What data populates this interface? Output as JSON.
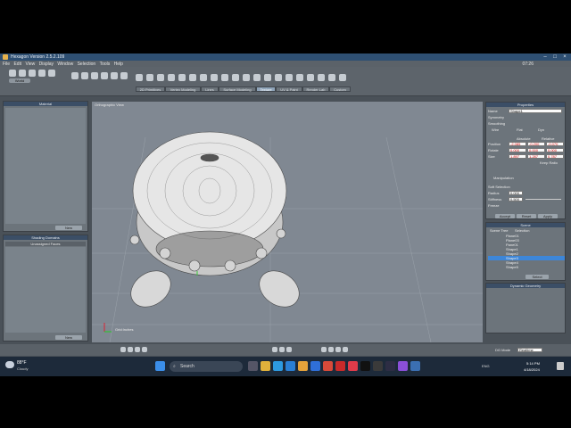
{
  "app": {
    "title": "Hexagon Version 2.5.2.109",
    "menus": [
      "File",
      "Edit",
      "View",
      "Display",
      "Window",
      "Selection",
      "Tools",
      "Help"
    ],
    "clock": "07:26",
    "tabs": [
      {
        "label": "2D Primitives",
        "active": false
      },
      {
        "label": "Vertex Modeling",
        "active": false
      },
      {
        "label": "Lines",
        "active": false
      },
      {
        "label": "Surface Modeling",
        "active": false
      },
      {
        "label": "Texture",
        "active": true
      },
      {
        "label": "UV & Paint",
        "active": false
      },
      {
        "label": "Render Lab",
        "active": false
      },
      {
        "label": "Custom",
        "active": false
      }
    ],
    "world_label": "World"
  },
  "left_panels": {
    "material_title": "Material",
    "material_button": "New",
    "shading_title": "Shading Domains",
    "shading_item": "Unassigned Faces",
    "shading_button": "New"
  },
  "viewport": {
    "label": "Orthographic View",
    "grid_label": "Grid:Inches"
  },
  "properties": {
    "title": "Properties",
    "name_label": "Name",
    "name_value": "Shape1",
    "symmetry_label": "Symmetry",
    "smoothing_label": "Smoothing",
    "mode_labels": [
      "Wire",
      "Flat",
      "Dyn"
    ],
    "absolute_label": "Absolute",
    "relative_label": "Relative",
    "position_label": "Position",
    "rotate_label": "Rotate",
    "size_label": "Size",
    "position": [
      "-2.085",
      "-0.200",
      "-0.070"
    ],
    "rotate": [
      "0.000",
      "0.000",
      "0.000"
    ],
    "size": [
      "1.897",
      "1.287",
      "0.787"
    ],
    "keep_ratio": "Keep Ratio",
    "manipulation_label": "Manipulation",
    "soft_selection_label": "Soft Selection",
    "radius_label": "Radius",
    "radius_value": "0.000",
    "stiffness_label": "Stiffness",
    "stiffness_value": "0.500",
    "freeze_label": "Freeze",
    "buttons": [
      "Accept",
      "Reset",
      "Apply"
    ]
  },
  "scene": {
    "title": "Scene",
    "tabs": [
      "Scene Tree",
      "Selection"
    ],
    "items": [
      {
        "label": "Plane01",
        "selected": false
      },
      {
        "label": "Plane03",
        "selected": false
      },
      {
        "label": "Pane01",
        "selected": false
      },
      {
        "label": "Shape1",
        "selected": false
      },
      {
        "label": "Shape2",
        "selected": false
      },
      {
        "label": "Shape3",
        "selected": true
      },
      {
        "label": "Shape4",
        "selected": false
      },
      {
        "label": "Shape5",
        "selected": false
      }
    ],
    "select_button": "Select",
    "dynamic_geometry_title": "Dynamic Geometry"
  },
  "statusbar": {
    "dg_mode_label": "DG Mode",
    "dg_mode_value": "Realtime"
  },
  "taskbar": {
    "weather_temp": "88°F",
    "weather_desc": "Cloudy",
    "search_placeholder": "Search",
    "tray_lang": "ENG",
    "time": "5:14 PM",
    "date": "4/18/2024"
  },
  "colors": {
    "titlebar": "#2e4f72",
    "panel_header": "#3b4e66",
    "viewport_bg": "#808892",
    "selection": "#3d86d8",
    "taskbar": "#1d2a3a"
  }
}
